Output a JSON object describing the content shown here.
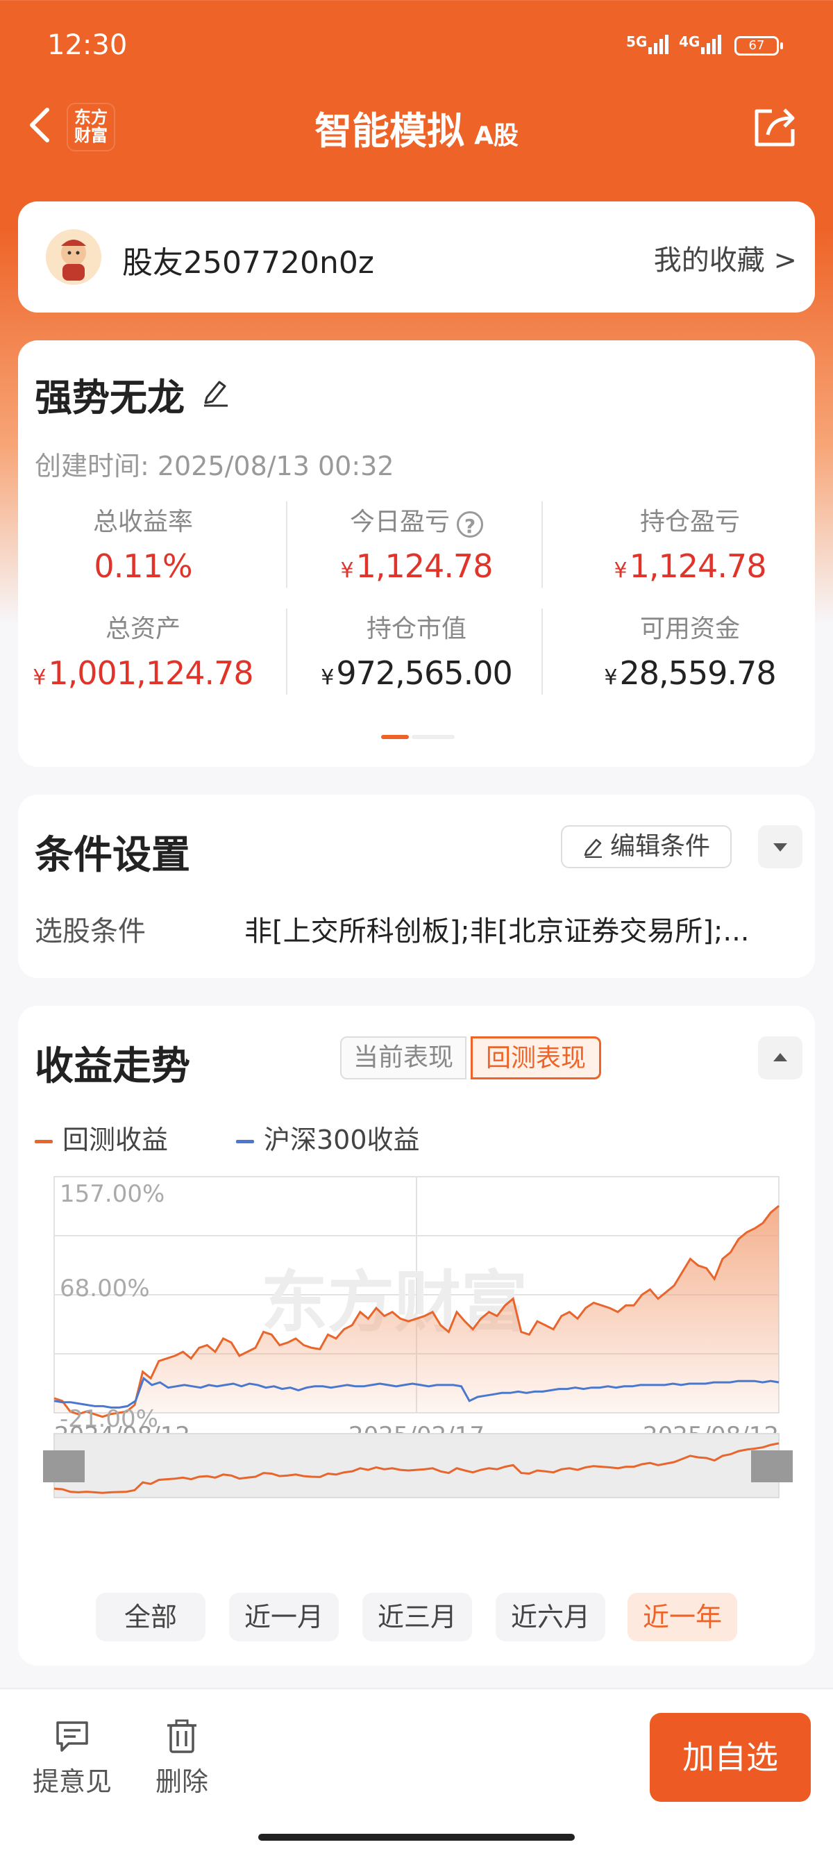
{
  "status_bar": {
    "time": "12:30",
    "network1": "5G",
    "network2": "4G",
    "battery": "67"
  },
  "header": {
    "title": "智能模拟",
    "tag": "A股",
    "logo_text": "东方财富"
  },
  "user": {
    "name": "股友2507720n0z",
    "favorites": "我的收藏 >"
  },
  "account": {
    "name": "强势无龙",
    "created": "创建时间:  2025/08/13 00:32",
    "currency": "¥",
    "stats": [
      {
        "label": "总收益率",
        "value": "0.11%",
        "currency": ""
      },
      {
        "label": "今日盈亏",
        "value": "1,124.78",
        "currency": "¥"
      },
      {
        "label": "持仓盈亏",
        "value": "1,124.78",
        "currency": "¥"
      },
      {
        "label": "总资产",
        "value": "1,001,124.78",
        "currency": "¥"
      },
      {
        "label": "持仓市值",
        "value": "972,565.00",
        "currency": "¥"
      },
      {
        "label": "可用资金",
        "value": "28,559.78",
        "currency": "¥"
      }
    ]
  },
  "conditions": {
    "title": "条件设置",
    "edit_label": "编辑条件",
    "label": "选股条件",
    "value": "非[上交所科创板];非[北京证券交易所];..."
  },
  "trend": {
    "title": "收益走势",
    "tab_current": "当前表现",
    "tab_backtest": "回测表现",
    "legend_backtest": "回测收益",
    "legend_hs300": "沪深300收益",
    "watermark": "东方财富",
    "ranges": [
      "全部",
      "近一月",
      "近三月",
      "近六月",
      "近一年"
    ],
    "active_range": "近一年"
  },
  "chart_data": {
    "type": "line",
    "x_labels": [
      "2024/08/12",
      "2025/02/17",
      "2025/08/12"
    ],
    "y_tick_labels": [
      "157.00%",
      "68.00%",
      "-21.00%"
    ],
    "ylim": [
      -21,
      157
    ],
    "grid": true,
    "legend": "top-left",
    "series": [
      {
        "name": "回测收益",
        "color": "#e8652c",
        "values": [
          -10,
          -12,
          -20,
          -22,
          -20,
          -22,
          -24,
          -22,
          -21,
          -20,
          -15,
          10,
          5,
          18,
          20,
          22,
          25,
          20,
          28,
          30,
          25,
          35,
          32,
          22,
          25,
          28,
          40,
          38,
          30,
          32,
          35,
          30,
          28,
          27,
          38,
          35,
          42,
          45,
          55,
          50,
          58,
          52,
          55,
          50,
          48,
          50,
          52,
          55,
          45,
          40,
          55,
          48,
          42,
          50,
          55,
          52,
          60,
          65,
          40,
          38,
          48,
          45,
          42,
          52,
          55,
          50,
          58,
          62,
          60,
          58,
          55,
          60,
          60,
          68,
          72,
          65,
          70,
          75,
          85,
          95,
          90,
          88,
          80,
          95,
          100,
          110,
          115,
          118,
          122,
          130,
          135
        ]
      },
      {
        "name": "沪深300收益",
        "color": "#4a78cf",
        "values": [
          -12,
          -13,
          -13,
          -14,
          -15,
          -16,
          -16,
          -17,
          -17,
          -16,
          -12,
          5,
          0,
          2,
          -2,
          -1,
          0,
          -1,
          -2,
          0,
          -1,
          0,
          1,
          -1,
          1,
          0,
          -2,
          -1,
          -3,
          -2,
          -4,
          -2,
          -1,
          -1,
          -2,
          -1,
          0,
          -1,
          -1,
          0,
          1,
          0,
          -1,
          0,
          1,
          0,
          -1,
          0,
          0,
          0,
          -1,
          -12,
          -9,
          -8,
          -7,
          -6,
          -6,
          -5,
          -6,
          -5,
          -5,
          -4,
          -3,
          -3,
          -2,
          -3,
          -2,
          -2,
          -1,
          -2,
          -1,
          -1,
          0,
          0,
          0,
          0,
          1,
          0,
          1,
          1,
          1,
          2,
          2,
          2,
          3,
          3,
          3,
          2,
          3,
          2
        ]
      }
    ]
  }
}
